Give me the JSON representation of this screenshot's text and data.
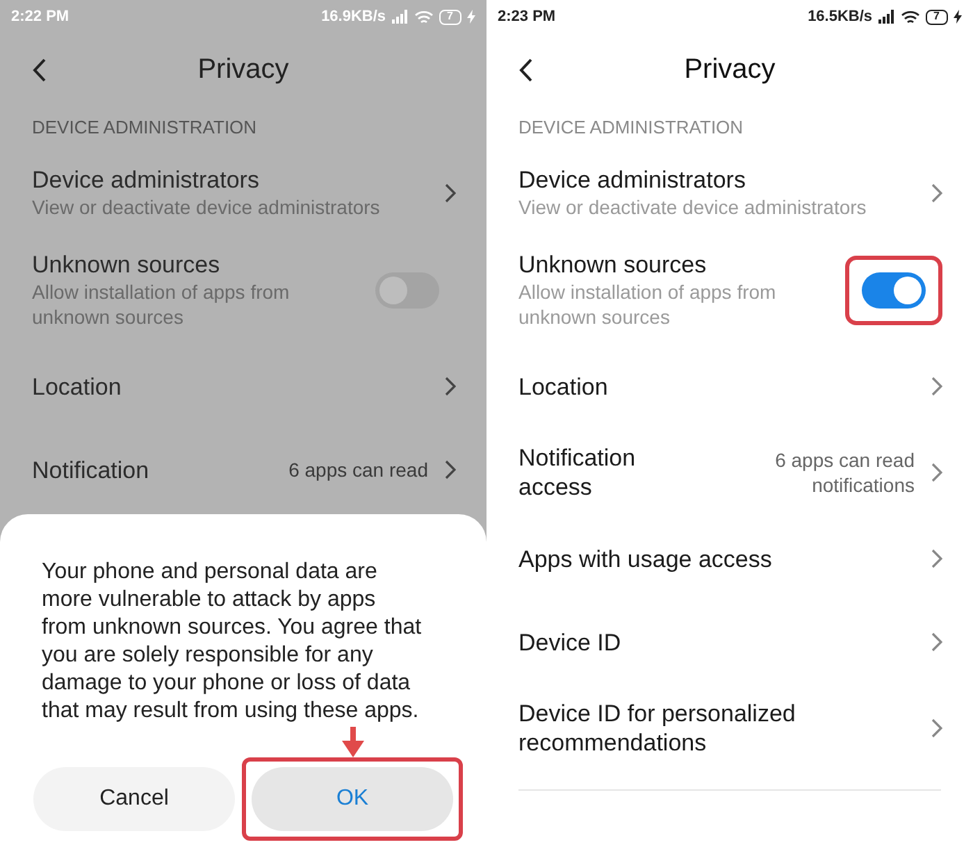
{
  "screens": [
    {
      "dimmed": true,
      "status_bar": {
        "time": "2:22 PM",
        "speed": "16.9KB/s",
        "battery": "7"
      },
      "title": "Privacy",
      "section": "DEVICE ADMINISTRATION",
      "items": [
        {
          "kind": "link",
          "title": "Device administrators",
          "subtitle": "View or deactivate device administrators"
        },
        {
          "kind": "toggle",
          "title": "Unknown sources",
          "subtitle": "Allow installation of apps from unknown sources",
          "on": false,
          "highlighted": false
        },
        {
          "kind": "link",
          "title": "Location"
        },
        {
          "kind": "link",
          "title": "Notification",
          "value": "6 apps can read"
        }
      ],
      "dialog": {
        "message": "Your phone and personal data are more vulnerable to attack by apps from unknown sources. You agree that you are solely responsible for any damage to your phone or loss of data that may result from using these apps.",
        "buttons": [
          {
            "label": "Cancel",
            "primary": false,
            "highlighted": false
          },
          {
            "label": "OK",
            "primary": true,
            "highlighted": true
          }
        ]
      }
    },
    {
      "dimmed": false,
      "status_bar": {
        "time": "2:23 PM",
        "speed": "16.5KB/s",
        "battery": "7"
      },
      "title": "Privacy",
      "section": "DEVICE ADMINISTRATION",
      "items": [
        {
          "kind": "link",
          "title": "Device administrators",
          "subtitle": "View or deactivate device administrators"
        },
        {
          "kind": "toggle",
          "title": "Unknown sources",
          "subtitle": "Allow installation of apps from unknown sources",
          "on": true,
          "highlighted": true
        },
        {
          "kind": "link",
          "title": "Location"
        },
        {
          "kind": "link",
          "title": "Notification access",
          "value": "6 apps can read notifications"
        },
        {
          "kind": "link",
          "title": "Apps with usage access"
        },
        {
          "kind": "link",
          "title": "Device ID"
        },
        {
          "kind": "link",
          "title": "Device ID for personalized recommendations"
        }
      ]
    }
  ]
}
